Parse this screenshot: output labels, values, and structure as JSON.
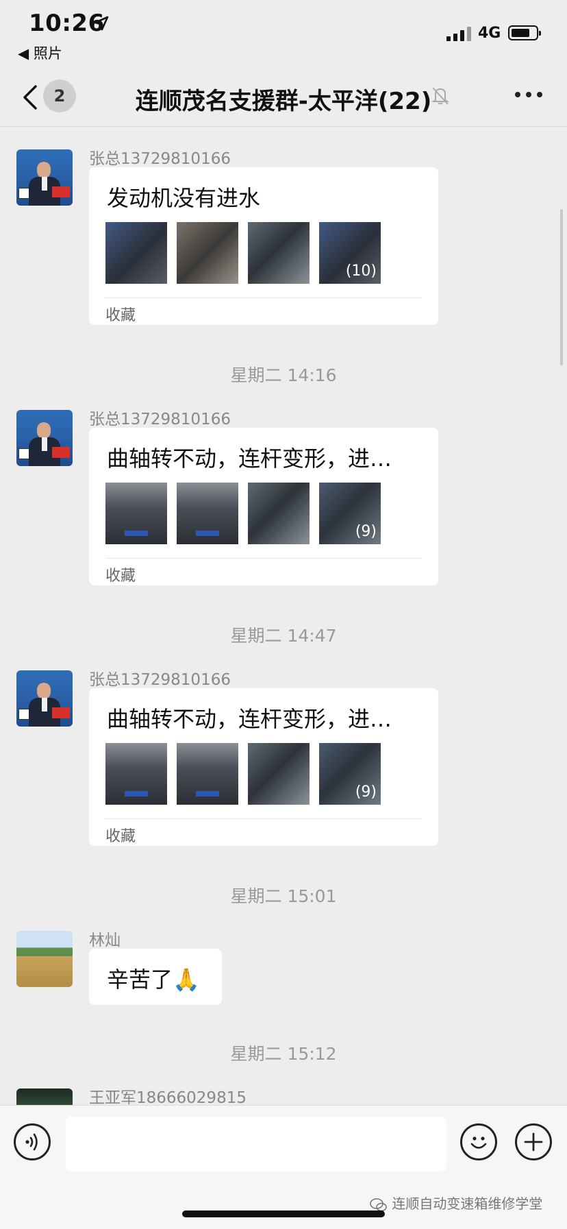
{
  "status_bar": {
    "time": "10:26",
    "back_app": "◀ 照片",
    "network": "4G",
    "battery_level": 0.75
  },
  "nav": {
    "unread_count": "2",
    "title": "连顺茂名支援群-太平洋(22)",
    "muted": true
  },
  "messages": [
    {
      "sender": "张总13729810166",
      "text": "发动机没有进水",
      "thumbs": [
        "engine-photo",
        "engine-photo",
        "engine-photo",
        "engine-photo"
      ],
      "more_count": "(10)",
      "footer": "收藏"
    },
    {
      "timestamp": "星期二 14:16",
      "sender": "张总13729810166",
      "text": "曲轴转不动，连杆变形，进…",
      "thumbs": [
        "car-photo",
        "car-photo",
        "engine-photo",
        "engine-photo"
      ],
      "more_count": "(9)",
      "footer": "收藏"
    },
    {
      "timestamp": "星期二 14:47",
      "sender": "张总13729810166",
      "text": "曲轴转不动，连杆变形，进…",
      "thumbs": [
        "car-photo",
        "car-photo",
        "engine-photo",
        "engine-photo"
      ],
      "more_count": "(9)",
      "footer": "收藏"
    },
    {
      "timestamp": "星期二 15:01",
      "sender": "林灿",
      "text": "辛苦了",
      "emoji": "🙏"
    },
    {
      "timestamp": "星期二 15:12",
      "sender": "王亚军18666029815"
    }
  ],
  "input": {
    "placeholder": "",
    "value": ""
  },
  "watermark": "连顺自动变速箱维修学堂",
  "icons": [
    "location-arrow-icon",
    "signal-icon",
    "battery-icon",
    "back-chevron-icon",
    "mute-bell-icon",
    "more-icon",
    "voice-icon",
    "emoji-icon",
    "plus-icon",
    "wechat-icon"
  ]
}
